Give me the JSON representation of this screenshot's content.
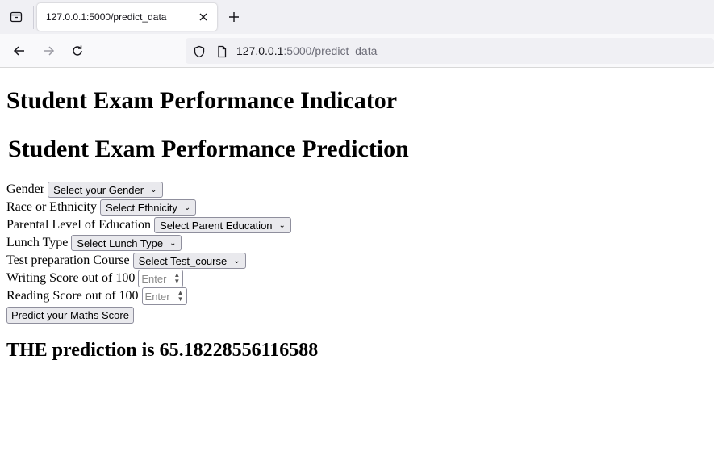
{
  "browser": {
    "tab_title": "127.0.0.1:5000/predict_data",
    "url_host": "127.0.0.1",
    "url_path": ":5000/predict_data"
  },
  "page": {
    "title": "Student Exam Performance Indicator",
    "subtitle": "Student Exam Performance Prediction"
  },
  "form": {
    "gender": {
      "label": "Gender",
      "value": "Select your Gender"
    },
    "ethnicity": {
      "label": "Race or Ethnicity",
      "value": "Select Ethnicity"
    },
    "parent_education": {
      "label": "Parental Level of Education",
      "value": "Select Parent Education"
    },
    "lunch": {
      "label": "Lunch Type",
      "value": "Select Lunch Type"
    },
    "test_prep": {
      "label": "Test preparation Course",
      "value": "Select Test_course"
    },
    "writing": {
      "label": "Writing Score out of 100",
      "placeholder": "Enter"
    },
    "reading": {
      "label": "Reading Score out of 100",
      "placeholder": "Enter"
    },
    "submit_label": "Predict your Maths Score"
  },
  "result": "THE prediction is 65.18228556116588"
}
